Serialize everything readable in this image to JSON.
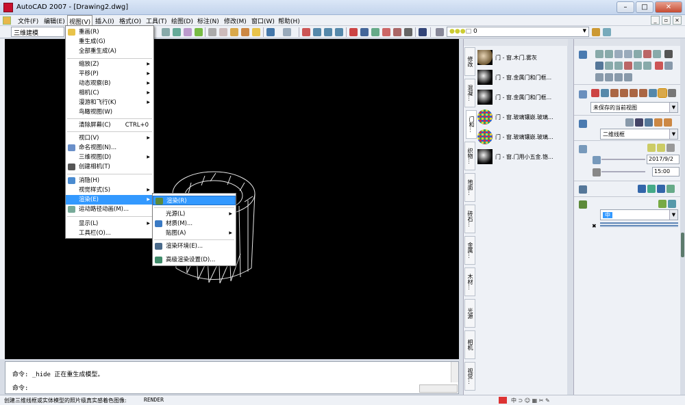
{
  "window": {
    "title": "AutoCAD 2007 - [Drawing2.dwg]"
  },
  "menubar": {
    "items": [
      "文件(F)",
      "编辑(E)",
      "视图(V)",
      "插入(I)",
      "格式(O)",
      "工具(T)",
      "绘图(D)",
      "标注(N)",
      "修改(M)",
      "窗口(W)",
      "帮助(H)"
    ]
  },
  "toolbar": {
    "workspace": "三维建模",
    "layer": "0"
  },
  "view_menu": {
    "items": [
      {
        "label": "重画(R)"
      },
      {
        "label": "重生成(G)"
      },
      {
        "label": "全部重生成(A)"
      },
      {
        "label": "缩放(Z)"
      },
      {
        "label": "平移(P)"
      },
      {
        "label": "动态观察(B)"
      },
      {
        "label": "相机(C)"
      },
      {
        "label": "漫游和飞行(K)"
      },
      {
        "label": "鸟瞰视图(W)"
      },
      {
        "label": "清除屏幕(C)",
        "shortcut": "CTRL+0"
      },
      {
        "label": "视口(V)"
      },
      {
        "label": "命名视图(N)..."
      },
      {
        "label": "三维视图(D)"
      },
      {
        "label": "创建相机(T)"
      },
      {
        "label": "消隐(H)"
      },
      {
        "label": "视觉样式(S)"
      },
      {
        "label": "渲染(E)"
      },
      {
        "label": "运动路径动画(M)..."
      },
      {
        "label": "显示(L)"
      },
      {
        "label": "工具栏(O)..."
      }
    ]
  },
  "render_menu": {
    "items": [
      {
        "label": "渲染(R)"
      },
      {
        "label": "光源(L)"
      },
      {
        "label": "材质(M)..."
      },
      {
        "label": "贴图(A)"
      },
      {
        "label": "渲染环境(E)..."
      },
      {
        "label": "高级渲染设置(D)..."
      }
    ]
  },
  "command": {
    "line1": "命令: _hide 正在重生成模型。",
    "prompt": "命令:"
  },
  "status": {
    "help": "创建三维线框或实体模型的照片级真实感着色图像:",
    "command": "RENDER"
  },
  "palette": {
    "tabs": [
      "修改",
      "混凝...",
      "门和...",
      "织物...",
      "地面...",
      "砖石...",
      "金属...",
      "木材...",
      "光源",
      "相机",
      "视觉..."
    ],
    "items": [
      {
        "label": "门 - 窗.木门.雾灰",
        "thumb": "wood"
      },
      {
        "label": "门 - 窗.金属门和门框...",
        "thumb": "dark"
      },
      {
        "label": "门 - 窗.金属门和门框...",
        "thumb": "dark"
      },
      {
        "label": "门 - 窗.玻璃镶嵌.玻璃...",
        "thumb": "mosaic"
      },
      {
        "label": "门 - 窗.玻璃镶嵌.玻璃...",
        "thumb": "mosaic"
      },
      {
        "label": "门 - 窗.门用小五金.铬...",
        "thumb": "dark"
      }
    ]
  },
  "dashboard": {
    "view": "未保存的当前视图",
    "visual_style": "二维线框",
    "date": "2017/9/2",
    "time": "15:00",
    "render_quality": "中"
  }
}
